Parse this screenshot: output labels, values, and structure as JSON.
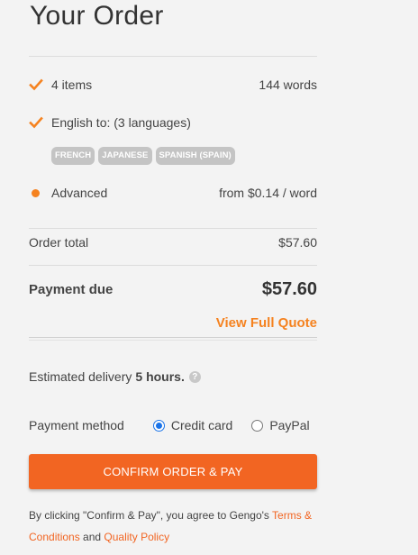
{
  "order": {
    "title": "Your Order",
    "items_label": "4 items",
    "words": "144 words",
    "translation_label": "English to: (3 languages)",
    "languages": [
      "FRENCH",
      "JAPANESE",
      "SPANISH (SPAIN)"
    ],
    "tier_label": "Advanced",
    "tier_price": "from $0.14 / word",
    "order_total_label": "Order total",
    "order_total_value": "$57.60",
    "payment_due_label": "Payment due",
    "payment_due_value": "$57.60",
    "view_quote": "View Full Quote"
  },
  "delivery": {
    "label": "Estimated delivery",
    "value": "5 hours.",
    "help_icon": "?"
  },
  "payment": {
    "label": "Payment method",
    "options": [
      {
        "label": "Credit card",
        "selected": true
      },
      {
        "label": "PayPal",
        "selected": false
      }
    ]
  },
  "confirm_button": "CONFIRM ORDER & PAY",
  "terms": {
    "prefix": "By clicking \"Confirm & Pay\", you agree to Gengo's ",
    "terms_link": "Terms & Conditions",
    "middle": " and ",
    "quality_link": "Quality Policy"
  },
  "colors": {
    "accent": "#f26522",
    "check": "#f5821f",
    "tag_bg": "#c4c4c4",
    "radio_selected": "#1a73e8"
  }
}
